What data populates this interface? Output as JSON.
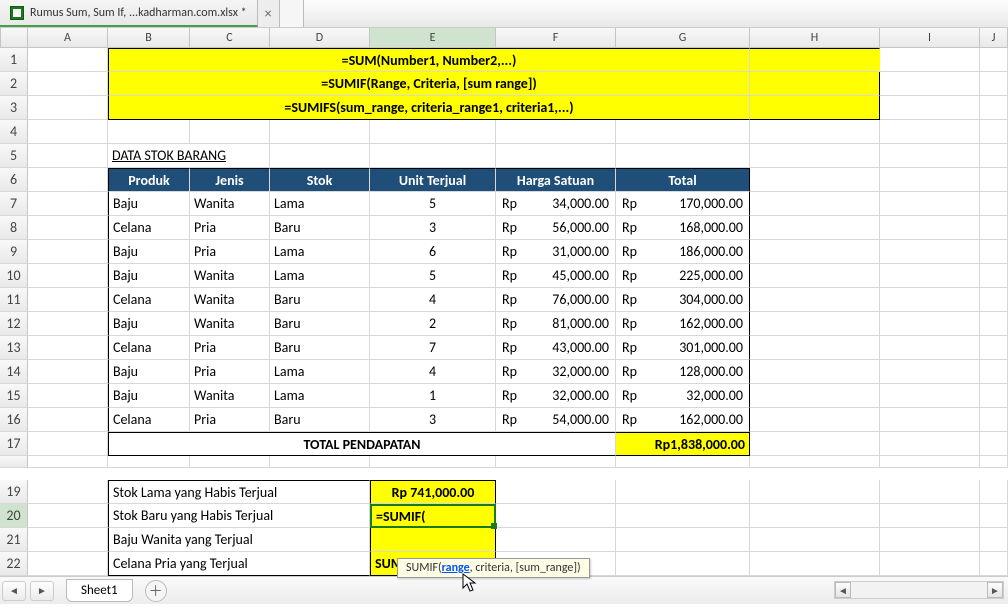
{
  "tab": {
    "filename": "Rumus Sum, Sum If, ...kadharman.com.xlsx *"
  },
  "columns": [
    "",
    "A",
    "B",
    "C",
    "D",
    "E",
    "F",
    "G",
    "H",
    "I",
    "J"
  ],
  "active_column_index": 5,
  "active_row": 20,
  "banners": {
    "r1": "=SUM(Number1, Number2,...)",
    "r2": "=SUMIF(Range, Criteria, [sum range])",
    "r3": "=SUMIFS(sum_range, criteria_range1, criteria1,...)"
  },
  "section_title": "DATA STOK BARANG",
  "headers": [
    "Produk",
    "Jenis",
    "Stok",
    "Unit Terjual",
    "Harga Satuan",
    "Total"
  ],
  "currency": "Rp",
  "rows": [
    {
      "n": 7,
      "produk": "Baju",
      "jenis": "Wanita",
      "stok": "Lama",
      "unit": "5",
      "harga": "34,000.00",
      "total": "170,000.00"
    },
    {
      "n": 8,
      "produk": "Celana",
      "jenis": "Pria",
      "stok": "Baru",
      "unit": "3",
      "harga": "56,000.00",
      "total": "168,000.00"
    },
    {
      "n": 9,
      "produk": "Baju",
      "jenis": "Pria",
      "stok": "Lama",
      "unit": "6",
      "harga": "31,000.00",
      "total": "186,000.00"
    },
    {
      "n": 10,
      "produk": "Baju",
      "jenis": "Wanita",
      "stok": "Lama",
      "unit": "5",
      "harga": "45,000.00",
      "total": "225,000.00"
    },
    {
      "n": 11,
      "produk": "Celana",
      "jenis": "Wanita",
      "stok": "Baru",
      "unit": "4",
      "harga": "76,000.00",
      "total": "304,000.00"
    },
    {
      "n": 12,
      "produk": "Baju",
      "jenis": "Wanita",
      "stok": "Baru",
      "unit": "2",
      "harga": "81,000.00",
      "total": "162,000.00"
    },
    {
      "n": 13,
      "produk": "Celana",
      "jenis": "Pria",
      "stok": "Baru",
      "unit": "7",
      "harga": "43,000.00",
      "total": "301,000.00"
    },
    {
      "n": 14,
      "produk": "Baju",
      "jenis": "Pria",
      "stok": "Lama",
      "unit": "4",
      "harga": "32,000.00",
      "total": "128,000.00"
    },
    {
      "n": 15,
      "produk": "Baju",
      "jenis": "Wanita",
      "stok": "Lama",
      "unit": "1",
      "harga": "32,000.00",
      "total": "32,000.00"
    },
    {
      "n": 16,
      "produk": "Celana",
      "jenis": "Pria",
      "stok": "Baru",
      "unit": "3",
      "harga": "54,000.00",
      "total": "162,000.00"
    }
  ],
  "total": {
    "label": "TOTAL PENDAPATAN",
    "value": "Rp1,838,000.00"
  },
  "summary": {
    "r19": {
      "label": "Stok Lama yang Habis Terjual",
      "value": "Rp 741,000.00"
    },
    "r20": {
      "label": "Stok Baru yang Habis Terjual",
      "value": "=SUMIF("
    },
    "r21": {
      "label": "Baju Wanita yang Terjual",
      "value": ""
    },
    "r22": {
      "label": "Celana Pria yang Terjual",
      "value": "SUMIFS 2"
    }
  },
  "tooltip": {
    "fn": "SUMIF(",
    "arg1": "range",
    "rest": ", criteria, [sum_range])"
  },
  "sheet": {
    "name": "Sheet1"
  },
  "rownums_extra": {
    "r1": "1",
    "r2": "2",
    "r3": "3",
    "r4": "4",
    "r5": "5",
    "r6": "6",
    "r17": "17",
    "r19": "19",
    "r20": "20",
    "r21": "21",
    "r22": "22"
  }
}
